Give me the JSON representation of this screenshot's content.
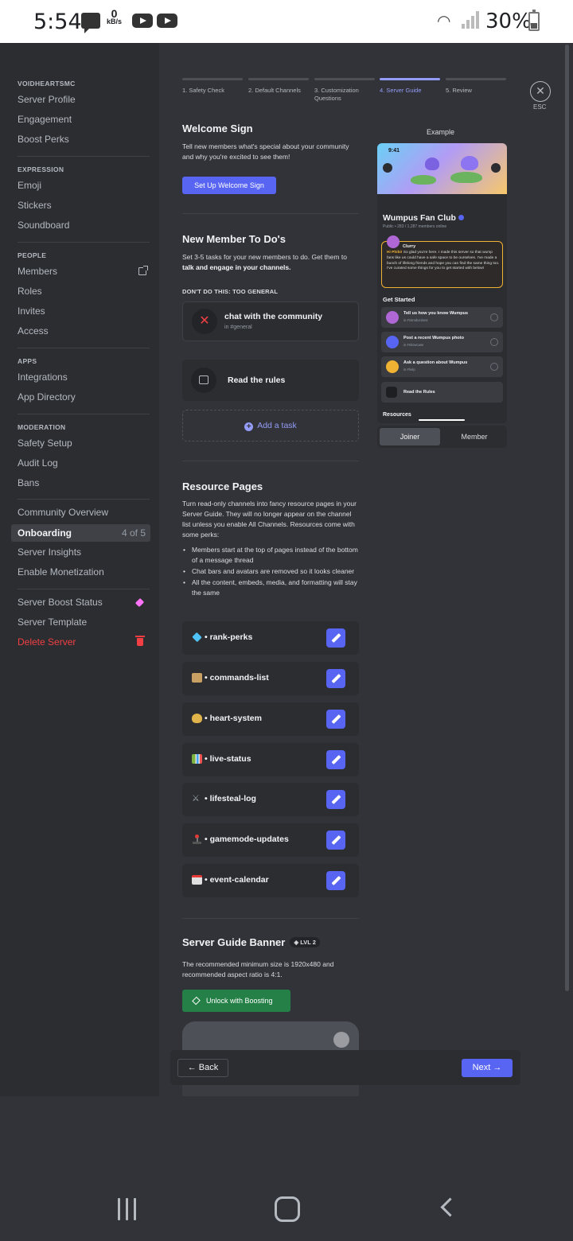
{
  "status_bar": {
    "time": "5:54",
    "net_speed_value": "0",
    "net_speed_unit": "kB/s",
    "battery": "30%"
  },
  "sidebar": {
    "server_name": "VOIDHEARTSMC",
    "general": [
      "Server Profile",
      "Engagement",
      "Boost Perks"
    ],
    "expression_header": "EXPRESSION",
    "expression": [
      "Emoji",
      "Stickers",
      "Soundboard"
    ],
    "people_header": "PEOPLE",
    "people": [
      "Members",
      "Roles",
      "Invites",
      "Access"
    ],
    "apps_header": "APPS",
    "apps": [
      "Integrations",
      "App Directory"
    ],
    "moderation_header": "MODERATION",
    "moderation": [
      "Safety Setup",
      "Audit Log",
      "Bans"
    ],
    "community": [
      "Community Overview",
      "Onboarding",
      "Server Insights",
      "Enable Monetization"
    ],
    "onboarding_progress": "4 of 5",
    "misc": [
      "Server Boost Status",
      "Server Template"
    ],
    "delete": "Delete Server",
    "danger_color": "#f23f43"
  },
  "steps": [
    {
      "label": "1. Safety Check"
    },
    {
      "label": "2. Default Channels"
    },
    {
      "label": "3. Customization Questions"
    },
    {
      "label": "4. Server Guide"
    },
    {
      "label": "5. Review"
    }
  ],
  "active_step_index": 3,
  "esc_label": "ESC",
  "welcome": {
    "title": "Welcome Sign",
    "desc": "Tell new members what's special about your community and why you're excited to see them!",
    "button": "Set Up Welcome Sign"
  },
  "todo": {
    "title": "New Member To Do's",
    "desc_pre": "Set 3-5 tasks for your new members to do. Get them to ",
    "desc_bold": "talk and engage in your channels.",
    "warning": "DON'T DO THIS: TOO GENERAL",
    "bad_example_title": "chat with the community",
    "bad_example_channel": "in #general",
    "task_title": "Read the rules",
    "add_task": "Add a task"
  },
  "resources": {
    "title": "Resource Pages",
    "desc": "Turn read-only channels into fancy resource pages in your Server Guide. They will no longer appear on the channel list unless you enable All Channels. Resources come with some perks:",
    "perks": [
      "Members start at the top of pages instead of the bottom of a message thread",
      "Chat bars and avatars are removed so it looks cleaner",
      "All the content, embeds, media, and formatting will stay the same"
    ],
    "pages": [
      {
        "name": "• rank-perks",
        "icon": "gem-emoji",
        "color": "#4fc3f7"
      },
      {
        "name": "• commands-list",
        "icon": "scroll-emoji",
        "color": "#c8a064"
      },
      {
        "name": "• heart-system",
        "icon": "money-bag-emoji",
        "color": "#e0b44a"
      },
      {
        "name": "• live-status",
        "icon": "bar-chart-emoji",
        "color": "#7cb342"
      },
      {
        "name": "• lifesteal-log",
        "icon": "crossed-swords-emoji",
        "color": "#9ea7ad"
      },
      {
        "name": "• gamemode-updates",
        "icon": "joystick-emoji",
        "color": "#e53935"
      },
      {
        "name": "• event-calendar",
        "icon": "calendar-emoji",
        "color": "#e0e0e0"
      }
    ]
  },
  "banner": {
    "title": "Server Guide Banner",
    "level": "LVL 2",
    "desc": "The recommended minimum size is 1920x480 and recommended aspect ratio is 4:1.",
    "button": "Unlock with Boosting"
  },
  "footer": {
    "back": "← Back",
    "next": "Next →"
  },
  "example": {
    "label": "Example",
    "phone_time": "9:41",
    "server_name": "Wumpus Fan Club",
    "meta": "Public  •  283 / 1,287 members online",
    "author": "Clurry",
    "message_bold": "Hi Phibi!",
    "message": " So glad you're here. I made this server so that wump fans like us could have a safe space to be ourselves. I've made a bunch of lifelong friends and hope you can find the same thing too. I've curated some things for you to get started with below!",
    "get_started": "Get Started",
    "tasks": [
      {
        "title": "Tell us how you know Wumpus",
        "sub": "in #introductions"
      },
      {
        "title": "Post a recent Wumpus photo",
        "sub": "in #showcase"
      },
      {
        "title": "Ask a question about Wumpus",
        "sub": "in #help"
      }
    ],
    "rules": "Read the Rules",
    "resources": "Resources",
    "toggle": [
      "Joiner",
      "Member"
    ]
  },
  "colors": {
    "accent": "#5865f2",
    "boost_green": "#248046",
    "bg": "#313338",
    "sidebar": "#2b2d31"
  }
}
